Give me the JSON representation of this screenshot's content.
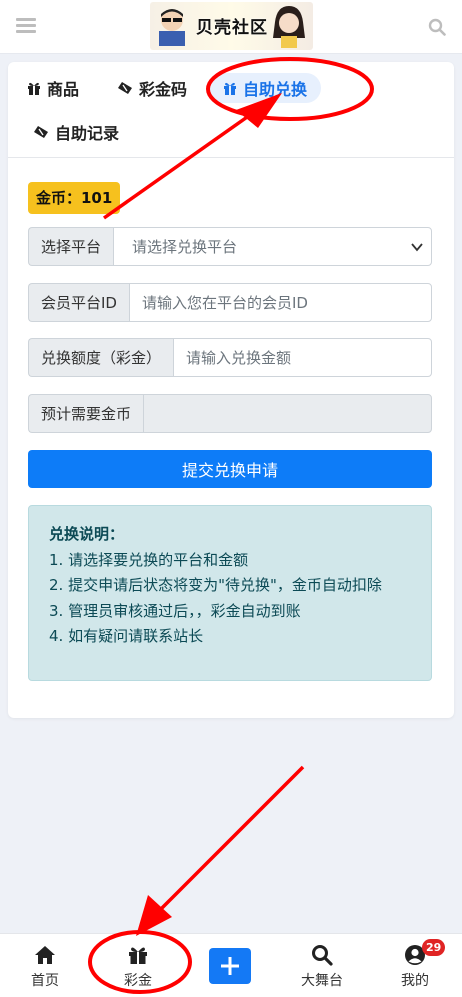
{
  "header": {
    "logo_text": "贝壳社区"
  },
  "tabs": [
    {
      "label": "商品",
      "icon": "gift-icon"
    },
    {
      "label": "彩金码",
      "icon": "ticket-icon"
    },
    {
      "label": "自助兑换",
      "icon": "gift-icon",
      "active": true
    },
    {
      "label": "自助记录",
      "icon": "ticket-icon"
    }
  ],
  "coins": {
    "label": "金币：101"
  },
  "form": {
    "platform": {
      "label": "选择平台",
      "placeholder": "请选择兑换平台"
    },
    "member_id": {
      "label": "会员平台ID",
      "placeholder": "请输入您在平台的会员ID"
    },
    "amount": {
      "label": "兑换额度（彩金）",
      "placeholder": "请输入兑换金额"
    },
    "required_coins": {
      "label": "预计需要金币",
      "value": ""
    },
    "submit_label": "提交兑换申请"
  },
  "info": {
    "title": "兑换说明：",
    "lines": [
      "1. 请选择要兑换的平台和金额",
      "2. 提交申请后状态将变为\"待兑换\"，金币自动扣除",
      "3. 管理员审核通过后，，彩金自动到账",
      "4. 如有疑问请联系站长"
    ]
  },
  "nav": {
    "home": "首页",
    "bonus": "彩金",
    "stage": "大舞台",
    "mine": "我的",
    "badge": "29"
  },
  "colors": {
    "accent": "#0d7cf8",
    "coin_badge": "#f6c11e",
    "info_bg": "#d1e7ea",
    "annotation": "#ff0000"
  }
}
